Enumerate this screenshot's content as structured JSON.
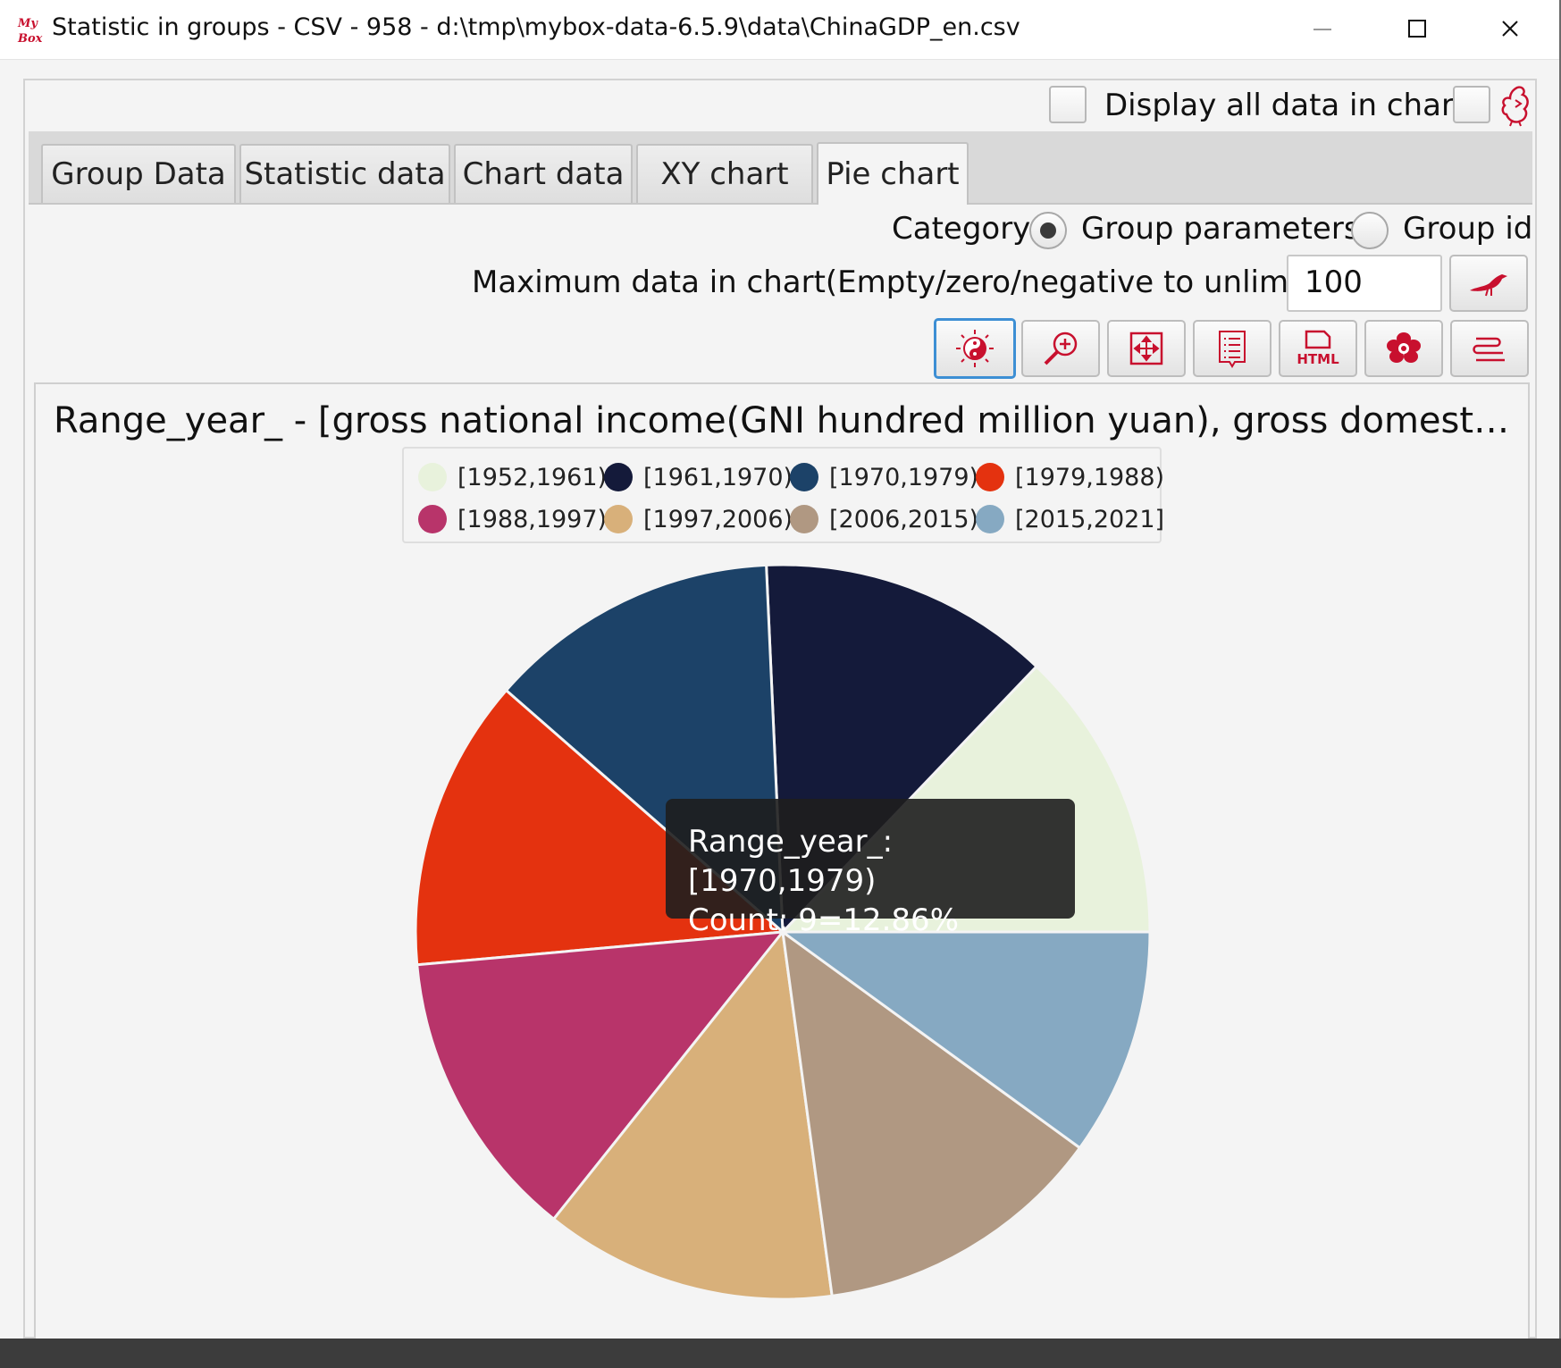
{
  "window": {
    "title": "Statistic in groups - CSV - 958 - d:\\tmp\\mybox-data-6.5.9\\data\\ChinaGDP_en.csv",
    "logo_text": "My Box"
  },
  "options": {
    "display_all_label": "Display all data in chart"
  },
  "tabs": [
    {
      "label": "Group Data"
    },
    {
      "label": "Statistic data"
    },
    {
      "label": "Chart data"
    },
    {
      "label": "XY chart"
    },
    {
      "label": "Pie chart",
      "active": true
    }
  ],
  "category": {
    "label": "Category",
    "options": [
      {
        "label": "Group parameters",
        "selected": true
      },
      {
        "label": "Group id",
        "selected": false
      }
    ]
  },
  "max_data": {
    "label": "Maximum data in chart(Empty/zero/negative to unlimit)",
    "value": "100"
  },
  "toolbar": {
    "icons": [
      "yin-yang-palette-icon",
      "zoom-in-icon",
      "fit-expand-icon",
      "text-data-icon",
      "html-icon",
      "peony-flower-icon",
      "menu-lines-icon"
    ],
    "html_label": "HTML"
  },
  "colors": {
    "accent_red": "#c8102e",
    "focus_blue": "#3d8fd4"
  },
  "tooltip": {
    "line1": "Range_year_: [1970,1979)",
    "line2": "Count: 9=12.86%"
  },
  "chart_data": {
    "type": "pie",
    "title": "Range_year_ - [gross national income(GNI hundred million yuan), gross domestic produc...",
    "legend_position": "top",
    "slices": [
      {
        "label": "[1952,1961)",
        "value": 9,
        "color": "#e8f2dc"
      },
      {
        "label": "[1961,1970)",
        "value": 9,
        "color": "#141a3a"
      },
      {
        "label": "[1970,1979)",
        "value": 9,
        "color": "#1c4268"
      },
      {
        "label": "[1979,1988)",
        "value": 9,
        "color": "#e4320f"
      },
      {
        "label": "[1988,1997)",
        "value": 9,
        "color": "#b8346a"
      },
      {
        "label": "[1997,2006)",
        "value": 9,
        "color": "#d8b07a"
      },
      {
        "label": "[2006,2015)",
        "value": 9,
        "color": "#b09882"
      },
      {
        "label": "[2015,2021]",
        "value": 7,
        "color": "#86a9c2"
      }
    ]
  }
}
